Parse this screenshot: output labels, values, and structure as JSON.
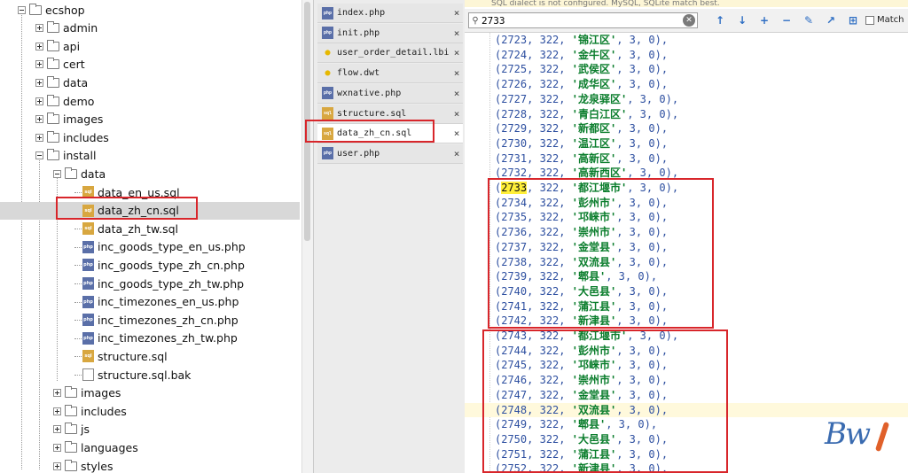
{
  "tree": {
    "rows": [
      {
        "label": "ecshop",
        "type": "folder",
        "toggle": "minus",
        "depth": 0
      },
      {
        "label": "admin",
        "type": "folder",
        "toggle": "plus",
        "depth": 1
      },
      {
        "label": "api",
        "type": "folder",
        "toggle": "plus",
        "depth": 1
      },
      {
        "label": "cert",
        "type": "folder",
        "toggle": "plus",
        "depth": 1
      },
      {
        "label": "data",
        "type": "folder",
        "toggle": "plus",
        "depth": 1
      },
      {
        "label": "demo",
        "type": "folder",
        "toggle": "plus",
        "depth": 1
      },
      {
        "label": "images",
        "type": "folder",
        "toggle": "plus",
        "depth": 1
      },
      {
        "label": "includes",
        "type": "folder",
        "toggle": "plus",
        "depth": 1
      },
      {
        "label": "install",
        "type": "folder",
        "toggle": "minus",
        "depth": 1
      },
      {
        "label": "data",
        "type": "folder",
        "toggle": "minus",
        "depth": 2
      },
      {
        "label": "data_en_us.sql",
        "type": "sql",
        "depth": 3
      },
      {
        "label": "data_zh_cn.sql",
        "type": "sql",
        "depth": 3,
        "selected": true
      },
      {
        "label": "data_zh_tw.sql",
        "type": "sql",
        "depth": 3
      },
      {
        "label": "inc_goods_type_en_us.php",
        "type": "php",
        "depth": 3
      },
      {
        "label": "inc_goods_type_zh_cn.php",
        "type": "php",
        "depth": 3
      },
      {
        "label": "inc_goods_type_zh_tw.php",
        "type": "php",
        "depth": 3
      },
      {
        "label": "inc_timezones_en_us.php",
        "type": "php",
        "depth": 3
      },
      {
        "label": "inc_timezones_zh_cn.php",
        "type": "php",
        "depth": 3
      },
      {
        "label": "inc_timezones_zh_tw.php",
        "type": "php",
        "depth": 3
      },
      {
        "label": "structure.sql",
        "type": "sql",
        "depth": 3
      },
      {
        "label": "structure.sql.bak",
        "type": "bak",
        "depth": 3
      },
      {
        "label": "images",
        "type": "folder",
        "toggle": "plus",
        "depth": 2
      },
      {
        "label": "includes",
        "type": "folder",
        "toggle": "plus",
        "depth": 2
      },
      {
        "label": "js",
        "type": "folder",
        "toggle": "plus",
        "depth": 2
      },
      {
        "label": "languages",
        "type": "folder",
        "toggle": "plus",
        "depth": 2
      },
      {
        "label": "styles",
        "type": "folder",
        "toggle": "plus",
        "depth": 2
      }
    ]
  },
  "tabs": [
    {
      "label": "index.php",
      "icon": "php",
      "close": "×"
    },
    {
      "label": "init.php",
      "icon": "php",
      "close": "×"
    },
    {
      "label": "user_order_detail.lbi",
      "icon": "bulb",
      "close": "×"
    },
    {
      "label": "flow.dwt",
      "icon": "bulb",
      "close": "×"
    },
    {
      "label": "wxnative.php",
      "icon": "php",
      "close": "×"
    },
    {
      "label": "structure.sql",
      "icon": "sql",
      "close": "×"
    },
    {
      "label": "data_zh_cn.sql",
      "icon": "sql",
      "close": "×",
      "active": true
    },
    {
      "label": "user.php",
      "icon": "php",
      "close": "×"
    }
  ],
  "message_bar": "SQL dialect is not configured. MySQL, SQLite match best.",
  "find": {
    "value": "2733",
    "clear_icon": "clear-icon",
    "buttons": [
      "↑",
      "↓",
      "+",
      "−",
      "✎",
      "↗",
      "⊞"
    ],
    "match_label": "Match"
  },
  "code_lines": [
    {
      "id": "2723",
      "name": "锦江区"
    },
    {
      "id": "2724",
      "name": "金牛区"
    },
    {
      "id": "2725",
      "name": "武侯区"
    },
    {
      "id": "2726",
      "name": "成华区"
    },
    {
      "id": "2727",
      "name": "龙泉驿区"
    },
    {
      "id": "2728",
      "name": "青白江区"
    },
    {
      "id": "2729",
      "name": "新都区"
    },
    {
      "id": "2730",
      "name": "温江区"
    },
    {
      "id": "2731",
      "name": "高新区"
    },
    {
      "id": "2732",
      "name": "高新西区"
    },
    {
      "id": "2733",
      "name": "都江堰市",
      "hit": true
    },
    {
      "id": "2734",
      "name": "彭州市"
    },
    {
      "id": "2735",
      "name": "邛崃市"
    },
    {
      "id": "2736",
      "name": "崇州市"
    },
    {
      "id": "2737",
      "name": "金堂县"
    },
    {
      "id": "2738",
      "name": "双流县"
    },
    {
      "id": "2739",
      "name": "郫县"
    },
    {
      "id": "2740",
      "name": "大邑县"
    },
    {
      "id": "2741",
      "name": "蒲江县"
    },
    {
      "id": "2742",
      "name": "新津县"
    },
    {
      "id": "2743",
      "name": "都江堰市"
    },
    {
      "id": "2744",
      "name": "彭州市"
    },
    {
      "id": "2745",
      "name": "邛崃市"
    },
    {
      "id": "2746",
      "name": "崇州市"
    },
    {
      "id": "2747",
      "name": "金堂县"
    },
    {
      "id": "2748",
      "name": "双流县",
      "current": true
    },
    {
      "id": "2749",
      "name": "郫县"
    },
    {
      "id": "2750",
      "name": "大邑县"
    },
    {
      "id": "2751",
      "name": "蒲江县"
    },
    {
      "id": "2752",
      "name": "新津县"
    }
  ],
  "code_parent": "322",
  "code_level": "3",
  "code_flag": "0",
  "colors": {
    "annotation": "#d8262b",
    "sql_string": "#0a7d2c",
    "sql_number": "#2d4fa0",
    "search_hit": "#ffef3a"
  },
  "watermark": {
    "text": "Bw"
  }
}
